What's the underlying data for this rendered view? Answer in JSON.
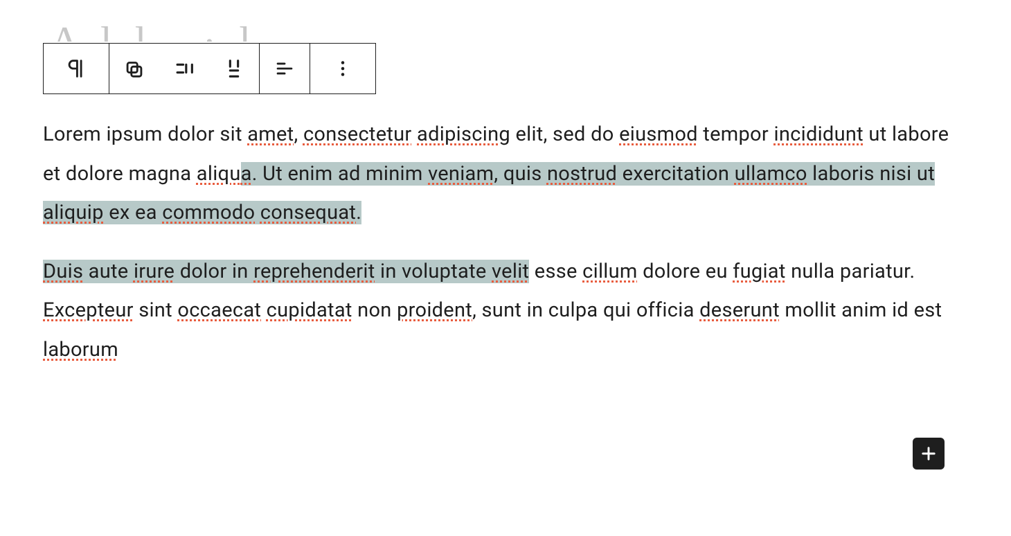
{
  "title_fragment": "A   l  l . · l",
  "toolbar": {
    "items": [
      {
        "name": "paragraph-icon",
        "icon": "pilcrow"
      },
      {
        "name": "drag-icon",
        "icon": "drag"
      },
      {
        "name": "move-up-icon",
        "icon": "moveh"
      },
      {
        "name": "move-down-icon",
        "icon": "movev"
      },
      {
        "name": "align-icon",
        "icon": "align"
      },
      {
        "name": "more-icon",
        "icon": "more"
      }
    ]
  },
  "paragraphs": [
    {
      "segments": [
        {
          "t": "Lorem ipsum dolor sit ",
          "sp": false,
          "sel": false
        },
        {
          "t": "amet",
          "sp": true,
          "sel": false
        },
        {
          "t": ", ",
          "sp": false,
          "sel": false
        },
        {
          "t": "consectetur",
          "sp": true,
          "sel": false
        },
        {
          "t": " ",
          "sp": false,
          "sel": false
        },
        {
          "t": "adipiscing",
          "sp": true,
          "sel": false
        },
        {
          "t": " elit, sed do ",
          "sp": false,
          "sel": false
        },
        {
          "t": "eiusmod",
          "sp": true,
          "sel": false
        },
        {
          "t": " tempor ",
          "sp": false,
          "sel": false
        },
        {
          "t": "incididunt",
          "sp": true,
          "sel": false
        },
        {
          "t": " ut labore et dolore magna ",
          "sp": false,
          "sel": false
        },
        {
          "t": "aliqu",
          "sp": true,
          "sel": false
        },
        {
          "t": "a",
          "sp": true,
          "sel": true
        },
        {
          "t": ". Ut enim ad minim ",
          "sp": false,
          "sel": true
        },
        {
          "t": "veniam",
          "sp": true,
          "sel": true
        },
        {
          "t": ", quis ",
          "sp": false,
          "sel": true
        },
        {
          "t": "nostrud",
          "sp": true,
          "sel": true
        },
        {
          "t": " exercitation ",
          "sp": false,
          "sel": true
        },
        {
          "t": "ullamco",
          "sp": true,
          "sel": true
        },
        {
          "t": " laboris nisi ut ",
          "sp": false,
          "sel": true
        },
        {
          "t": "aliquip",
          "sp": true,
          "sel": true
        },
        {
          "t": " ex ea ",
          "sp": false,
          "sel": true
        },
        {
          "t": "commodo",
          "sp": true,
          "sel": true
        },
        {
          "t": " ",
          "sp": false,
          "sel": true
        },
        {
          "t": "consequat",
          "sp": true,
          "sel": true
        },
        {
          "t": ". ",
          "sp": false,
          "sel": true
        }
      ]
    },
    {
      "segments": [
        {
          "t": "Duis",
          "sp": true,
          "sel": true
        },
        {
          "t": " aute ",
          "sp": false,
          "sel": true
        },
        {
          "t": "irure",
          "sp": true,
          "sel": true
        },
        {
          "t": " dolor in ",
          "sp": false,
          "sel": true
        },
        {
          "t": "reprehenderit",
          "sp": true,
          "sel": true
        },
        {
          "t": " in voluptate ",
          "sp": false,
          "sel": true
        },
        {
          "t": "velit",
          "sp": true,
          "sel": true
        },
        {
          "t": " esse ",
          "sp": false,
          "sel": false
        },
        {
          "t": "cillum",
          "sp": true,
          "sel": false
        },
        {
          "t": " dolore eu ",
          "sp": false,
          "sel": false
        },
        {
          "t": "fugiat",
          "sp": true,
          "sel": false
        },
        {
          "t": " nulla pariatur. ",
          "sp": false,
          "sel": false
        },
        {
          "t": "Excepteur",
          "sp": true,
          "sel": false
        },
        {
          "t": " sint ",
          "sp": false,
          "sel": false
        },
        {
          "t": "occaecat",
          "sp": true,
          "sel": false
        },
        {
          "t": " ",
          "sp": false,
          "sel": false
        },
        {
          "t": "cupidatat",
          "sp": true,
          "sel": false
        },
        {
          "t": " non ",
          "sp": false,
          "sel": false
        },
        {
          "t": "proident",
          "sp": true,
          "sel": false
        },
        {
          "t": ", sunt in culpa qui officia ",
          "sp": false,
          "sel": false
        },
        {
          "t": "deserunt",
          "sp": true,
          "sel": false
        },
        {
          "t": " mollit anim id est ",
          "sp": false,
          "sel": false
        },
        {
          "t": "laborum",
          "sp": true,
          "sel": false
        }
      ]
    }
  ],
  "add_button": {
    "name": "add-block-button"
  }
}
